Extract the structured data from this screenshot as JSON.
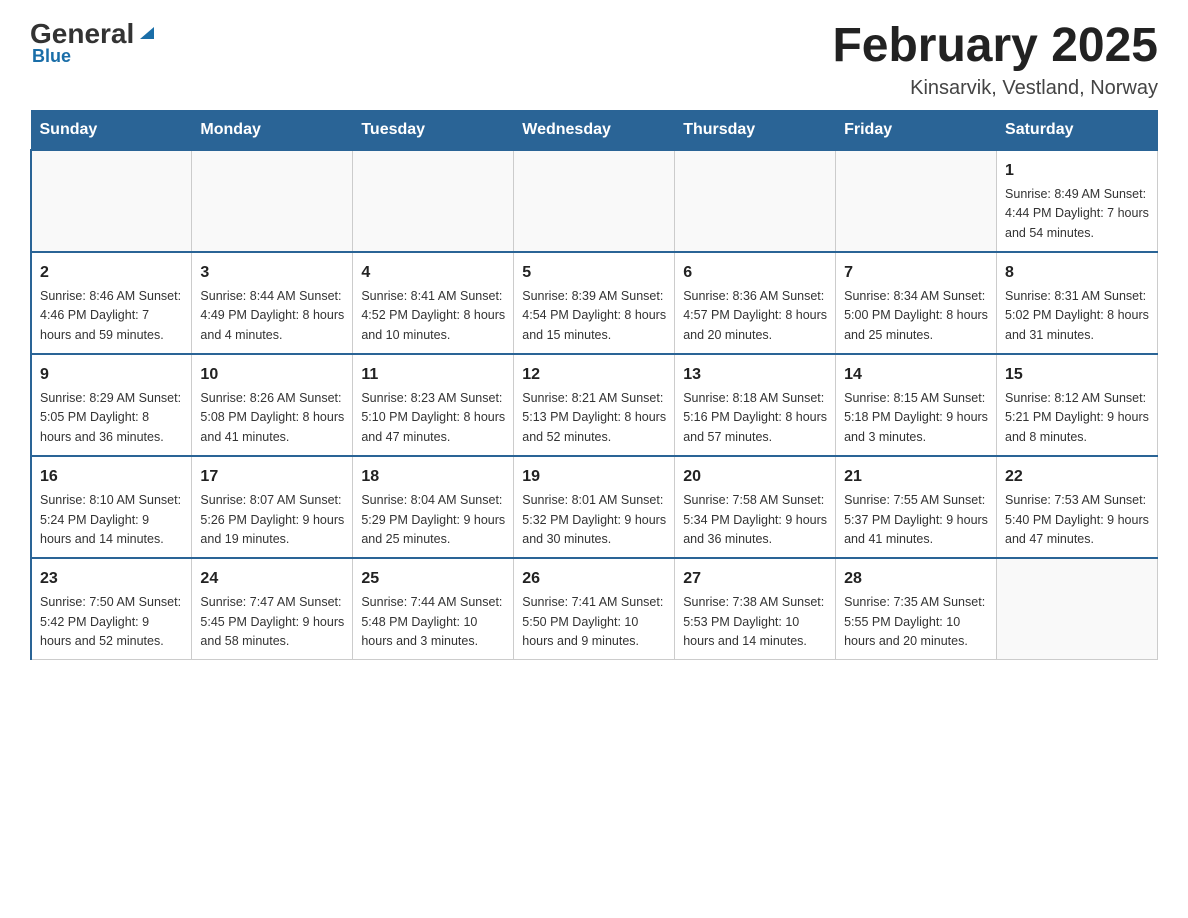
{
  "logo": {
    "general": "General",
    "blue": "Blue"
  },
  "header": {
    "title": "February 2025",
    "subtitle": "Kinsarvik, Vestland, Norway"
  },
  "days_of_week": [
    "Sunday",
    "Monday",
    "Tuesday",
    "Wednesday",
    "Thursday",
    "Friday",
    "Saturday"
  ],
  "weeks": [
    [
      {
        "day": "",
        "info": ""
      },
      {
        "day": "",
        "info": ""
      },
      {
        "day": "",
        "info": ""
      },
      {
        "day": "",
        "info": ""
      },
      {
        "day": "",
        "info": ""
      },
      {
        "day": "",
        "info": ""
      },
      {
        "day": "1",
        "info": "Sunrise: 8:49 AM\nSunset: 4:44 PM\nDaylight: 7 hours and 54 minutes."
      }
    ],
    [
      {
        "day": "2",
        "info": "Sunrise: 8:46 AM\nSunset: 4:46 PM\nDaylight: 7 hours and 59 minutes."
      },
      {
        "day": "3",
        "info": "Sunrise: 8:44 AM\nSunset: 4:49 PM\nDaylight: 8 hours and 4 minutes."
      },
      {
        "day": "4",
        "info": "Sunrise: 8:41 AM\nSunset: 4:52 PM\nDaylight: 8 hours and 10 minutes."
      },
      {
        "day": "5",
        "info": "Sunrise: 8:39 AM\nSunset: 4:54 PM\nDaylight: 8 hours and 15 minutes."
      },
      {
        "day": "6",
        "info": "Sunrise: 8:36 AM\nSunset: 4:57 PM\nDaylight: 8 hours and 20 minutes."
      },
      {
        "day": "7",
        "info": "Sunrise: 8:34 AM\nSunset: 5:00 PM\nDaylight: 8 hours and 25 minutes."
      },
      {
        "day": "8",
        "info": "Sunrise: 8:31 AM\nSunset: 5:02 PM\nDaylight: 8 hours and 31 minutes."
      }
    ],
    [
      {
        "day": "9",
        "info": "Sunrise: 8:29 AM\nSunset: 5:05 PM\nDaylight: 8 hours and 36 minutes."
      },
      {
        "day": "10",
        "info": "Sunrise: 8:26 AM\nSunset: 5:08 PM\nDaylight: 8 hours and 41 minutes."
      },
      {
        "day": "11",
        "info": "Sunrise: 8:23 AM\nSunset: 5:10 PM\nDaylight: 8 hours and 47 minutes."
      },
      {
        "day": "12",
        "info": "Sunrise: 8:21 AM\nSunset: 5:13 PM\nDaylight: 8 hours and 52 minutes."
      },
      {
        "day": "13",
        "info": "Sunrise: 8:18 AM\nSunset: 5:16 PM\nDaylight: 8 hours and 57 minutes."
      },
      {
        "day": "14",
        "info": "Sunrise: 8:15 AM\nSunset: 5:18 PM\nDaylight: 9 hours and 3 minutes."
      },
      {
        "day": "15",
        "info": "Sunrise: 8:12 AM\nSunset: 5:21 PM\nDaylight: 9 hours and 8 minutes."
      }
    ],
    [
      {
        "day": "16",
        "info": "Sunrise: 8:10 AM\nSunset: 5:24 PM\nDaylight: 9 hours and 14 minutes."
      },
      {
        "day": "17",
        "info": "Sunrise: 8:07 AM\nSunset: 5:26 PM\nDaylight: 9 hours and 19 minutes."
      },
      {
        "day": "18",
        "info": "Sunrise: 8:04 AM\nSunset: 5:29 PM\nDaylight: 9 hours and 25 minutes."
      },
      {
        "day": "19",
        "info": "Sunrise: 8:01 AM\nSunset: 5:32 PM\nDaylight: 9 hours and 30 minutes."
      },
      {
        "day": "20",
        "info": "Sunrise: 7:58 AM\nSunset: 5:34 PM\nDaylight: 9 hours and 36 minutes."
      },
      {
        "day": "21",
        "info": "Sunrise: 7:55 AM\nSunset: 5:37 PM\nDaylight: 9 hours and 41 minutes."
      },
      {
        "day": "22",
        "info": "Sunrise: 7:53 AM\nSunset: 5:40 PM\nDaylight: 9 hours and 47 minutes."
      }
    ],
    [
      {
        "day": "23",
        "info": "Sunrise: 7:50 AM\nSunset: 5:42 PM\nDaylight: 9 hours and 52 minutes."
      },
      {
        "day": "24",
        "info": "Sunrise: 7:47 AM\nSunset: 5:45 PM\nDaylight: 9 hours and 58 minutes."
      },
      {
        "day": "25",
        "info": "Sunrise: 7:44 AM\nSunset: 5:48 PM\nDaylight: 10 hours and 3 minutes."
      },
      {
        "day": "26",
        "info": "Sunrise: 7:41 AM\nSunset: 5:50 PM\nDaylight: 10 hours and 9 minutes."
      },
      {
        "day": "27",
        "info": "Sunrise: 7:38 AM\nSunset: 5:53 PM\nDaylight: 10 hours and 14 minutes."
      },
      {
        "day": "28",
        "info": "Sunrise: 7:35 AM\nSunset: 5:55 PM\nDaylight: 10 hours and 20 minutes."
      },
      {
        "day": "",
        "info": ""
      }
    ]
  ]
}
